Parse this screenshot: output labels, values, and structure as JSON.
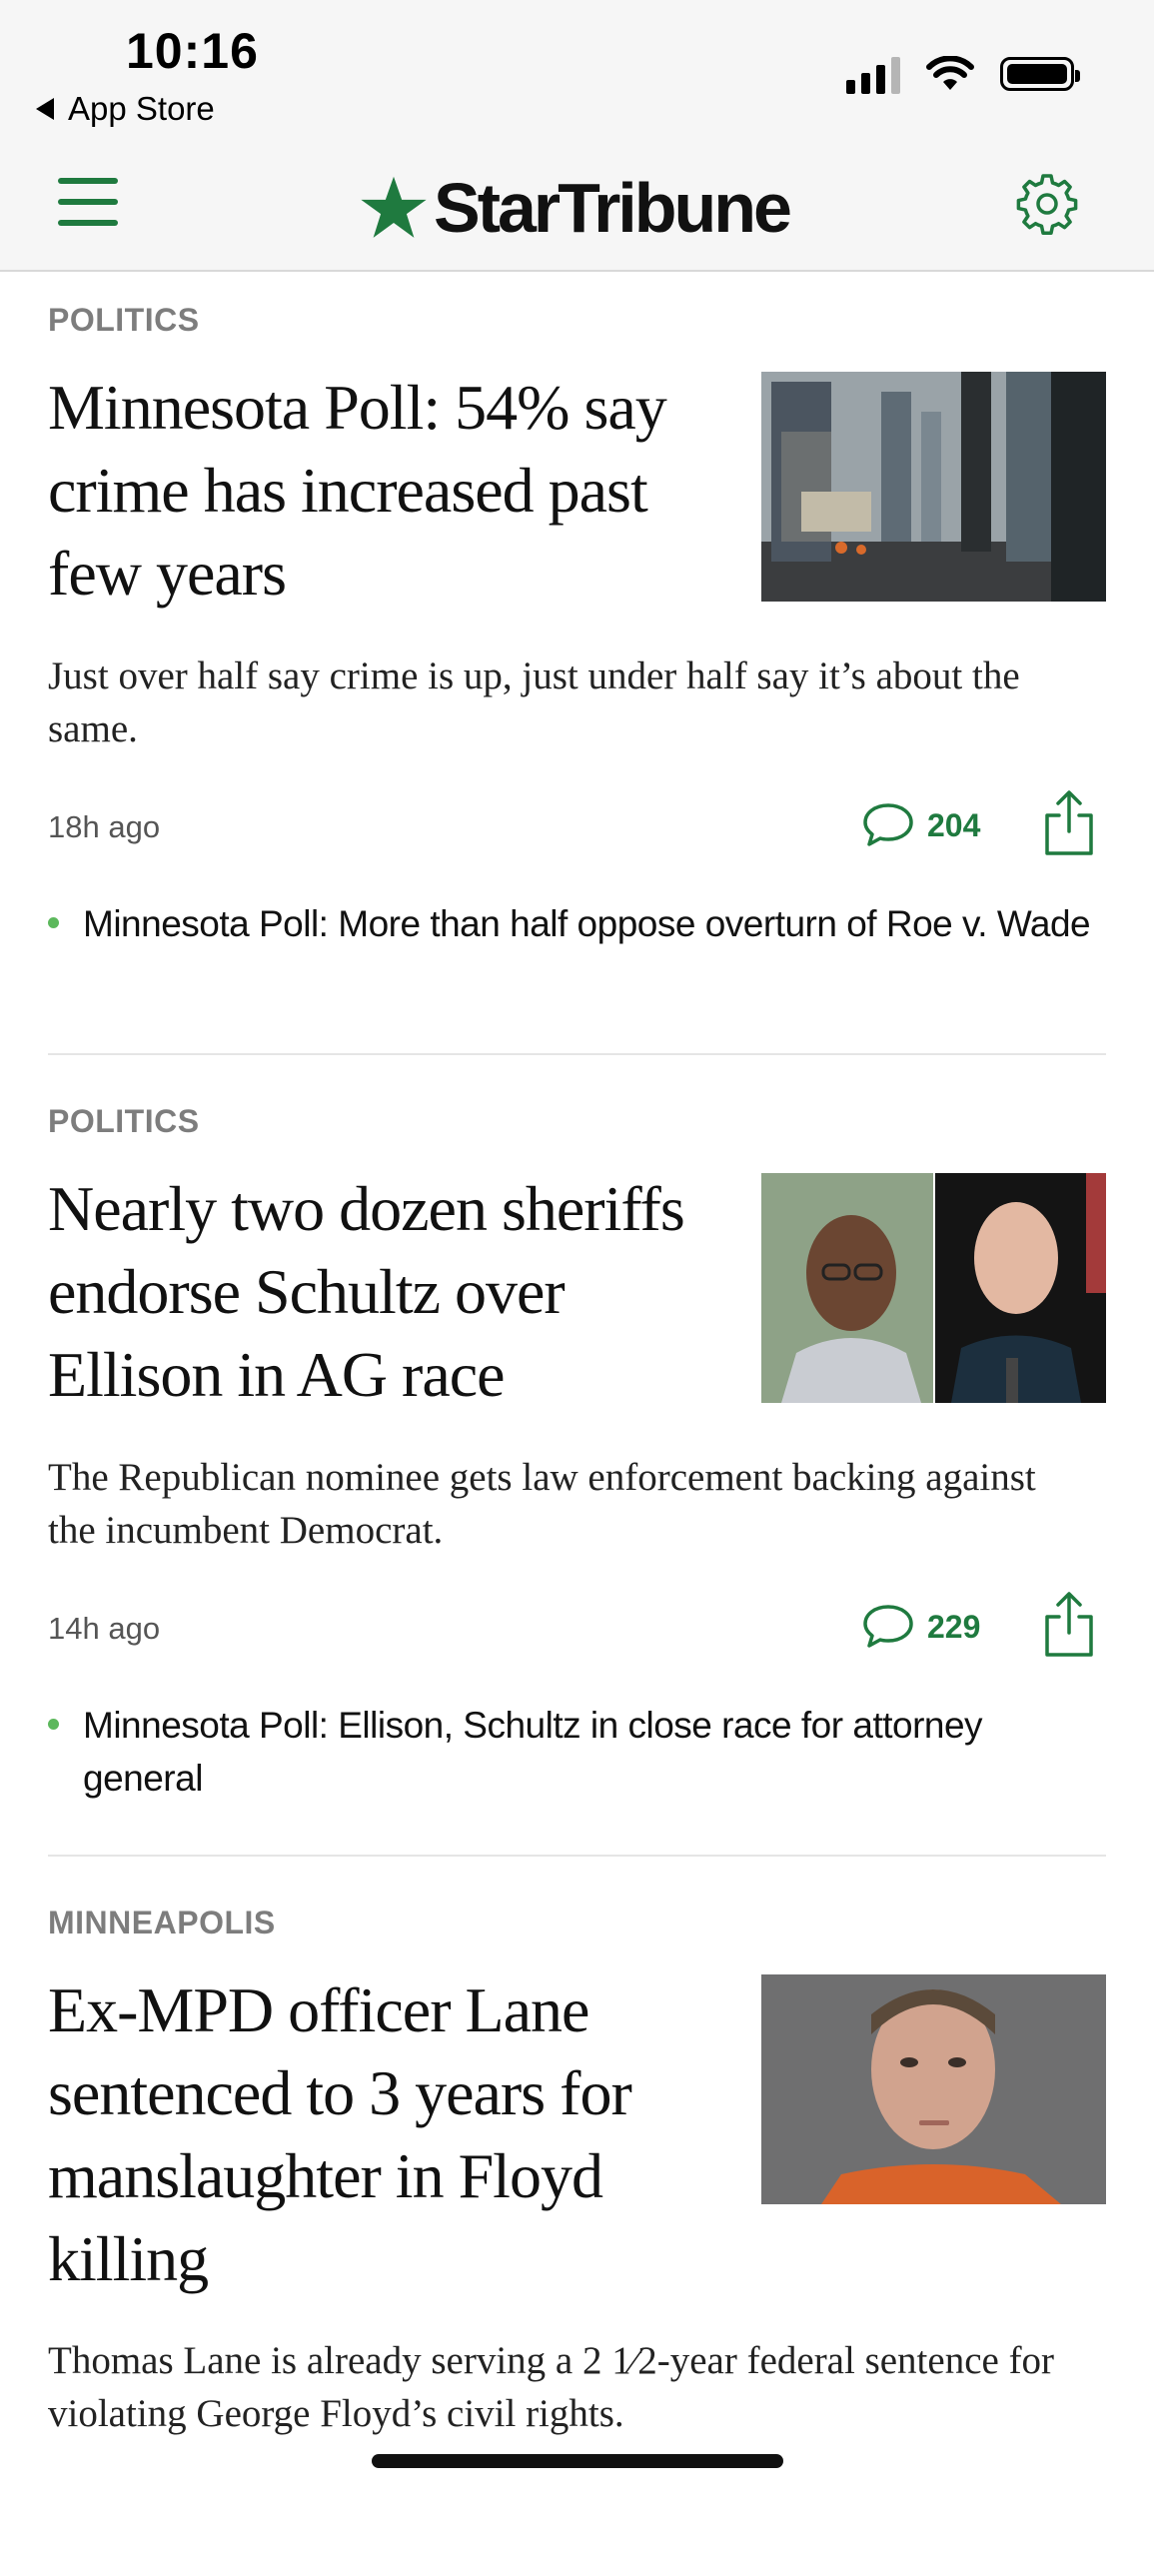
{
  "status_bar": {
    "time": "10:16",
    "back_label": "App Store"
  },
  "header": {
    "brand": "StarTribune",
    "menu_icon": "hamburger-menu-icon",
    "settings_icon": "gear-icon",
    "brand_color": "#1f7a3f"
  },
  "stories": [
    {
      "section": "POLITICS",
      "headline": "Minnesota Poll: 54% say crime has increased past few years",
      "summary": "Just over half say crime is up, just under half say it’s about the same.",
      "time": "18h ago",
      "comments": "204",
      "related": "Minnesota Poll: More than half oppose overturn of Roe v. Wade",
      "image": "city-street-skyline-photo"
    },
    {
      "section": "POLITICS",
      "headline": "Nearly two dozen sheriffs endorse Schultz over Ellison in AG race",
      "summary": "The Republican nominee gets law enforcement backing against the incumbent Democrat.",
      "time": "14h ago",
      "comments": "229",
      "related": "Minnesota Poll: Ellison, Schultz in close race for attorney general",
      "image": "two-candidates-portrait-photo"
    },
    {
      "section": "MINNEAPOLIS",
      "headline": "Ex-MPD officer Lane sentenced to 3 years for manslaughter in Floyd killing",
      "summary": "Thomas Lane is already serving a 2 1⁄2-year federal sentence for violating George Floyd’s civil rights.",
      "image": "booking-photo"
    }
  ]
}
